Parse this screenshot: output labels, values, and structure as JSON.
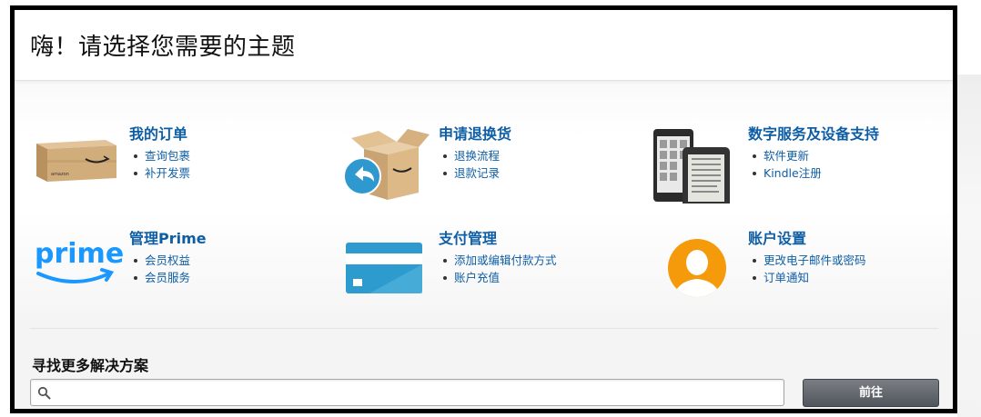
{
  "header": {
    "title": "嗨！请选择您需要的主题"
  },
  "tiles": [
    {
      "title": "我的订单",
      "links": [
        "查询包裹",
        "补开发票"
      ],
      "icon": "package-box-icon"
    },
    {
      "title": "申请退换货",
      "links": [
        "退换流程",
        "退款记录"
      ],
      "icon": "return-box-icon"
    },
    {
      "title": "数字服务及设备支持",
      "links": [
        "软件更新",
        "Kindle注册"
      ],
      "icon": "kindle-devices-icon"
    },
    {
      "title": "管理Prime",
      "links": [
        "会员权益",
        "会员服务"
      ],
      "icon": "prime-logo-icon"
    },
    {
      "title": "支付管理",
      "links": [
        "添加或编辑付款方式",
        "账户充值"
      ],
      "icon": "credit-card-icon"
    },
    {
      "title": "账户设置",
      "links": [
        "更改电子邮件或密码",
        "订单通知"
      ],
      "icon": "user-avatar-icon"
    }
  ],
  "prime_logo_text": "prime",
  "box_label": "amazon",
  "more": {
    "title": "寻找更多解决方案",
    "search_value": "",
    "search_placeholder": "",
    "go_label": "前往"
  },
  "colors": {
    "link": "#0e5ea5",
    "prime_blue": "#1a98ff",
    "avatar_orange": "#f59a0b",
    "card_blue": "#2e9bce",
    "button_dark": "#5b6067"
  }
}
